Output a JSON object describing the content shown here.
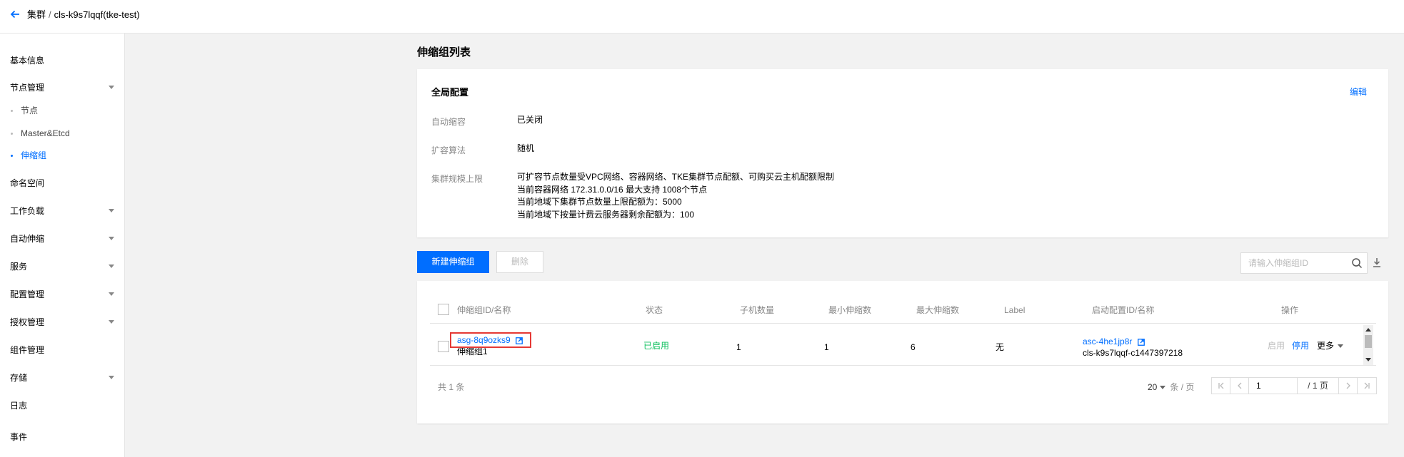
{
  "header": {
    "breadcrumb_root": "集群",
    "breadcrumb_sep": "/",
    "breadcrumb_current": "cls-k9s7lqqf(tke-test)"
  },
  "sidebar": {
    "items": [
      {
        "label": "基本信息"
      },
      {
        "label": "节点管理"
      },
      {
        "label": "节点"
      },
      {
        "label": "Master&Etcd"
      },
      {
        "label": "伸缩组"
      },
      {
        "label": "命名空间"
      },
      {
        "label": "工作负载"
      },
      {
        "label": "自动伸缩"
      },
      {
        "label": "服务"
      },
      {
        "label": "配置管理"
      },
      {
        "label": "授权管理"
      },
      {
        "label": "组件管理"
      },
      {
        "label": "存储"
      },
      {
        "label": "日志"
      },
      {
        "label": "事件"
      }
    ]
  },
  "main": {
    "title": "伸缩组列表",
    "global": {
      "title": "全局配置",
      "edit": "编辑",
      "rows": [
        {
          "label": "自动缩容",
          "value": "已关闭"
        },
        {
          "label": "扩容算法",
          "value": "随机"
        },
        {
          "label": "集群规模上限",
          "lines": [
            "可扩容节点数量受VPC网络、容器网络、TKE集群节点配额、可购买云主机配额限制",
            "当前容器网络 172.31.0.0/16 最大支持 1008个节点",
            "当前地域下集群节点数量上限配额为：5000",
            "当前地域下按量计费云服务器剩余配额为：100"
          ]
        }
      ]
    },
    "toolbar": {
      "create": "新建伸缩组",
      "delete": "删除",
      "search_placeholder": "请输入伸缩组ID"
    },
    "table": {
      "headers": [
        "伸缩组ID/名称",
        "状态",
        "子机数量",
        "最小伸缩数",
        "最大伸缩数",
        "Label",
        "启动配置ID/名称",
        "操作"
      ],
      "rows": [
        {
          "id": "asg-8q9ozks9",
          "name": "伸缩组1",
          "status": "已启用",
          "count": "1",
          "min": "1",
          "max": "6",
          "label": "无",
          "config_id": "asc-4he1jp8r",
          "config_name": "cls-k9s7lqqf-c1447397218",
          "op_enable": "启用",
          "op_disable": "停用",
          "op_more": "更多"
        }
      ]
    },
    "pagination": {
      "total": "共 1 条",
      "page_size": "20",
      "page_size_unit": "条 / 页",
      "page": "1",
      "total_pages": "/ 1 页"
    }
  },
  "colors": {
    "primary": "#006eff",
    "success": "#0abf5b",
    "highlight": "#e53935"
  }
}
